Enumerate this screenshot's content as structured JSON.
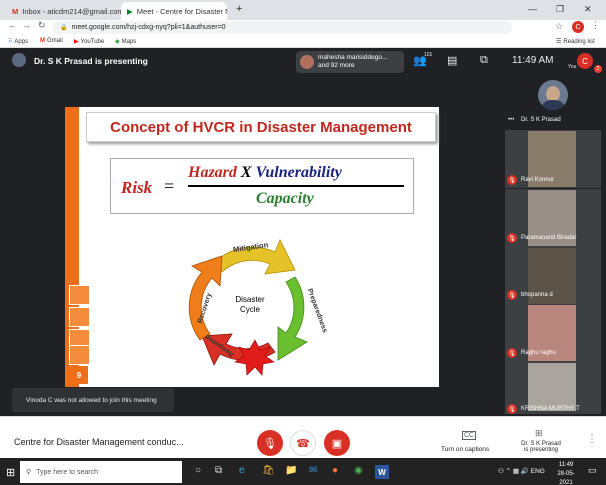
{
  "browser": {
    "tabs": [
      {
        "title": "Inbox - aticdm214@gmail.com -"
      },
      {
        "title": "Meet - Centre for Disaster M"
      }
    ],
    "new_tab": "+",
    "url": "meet.google.com/hzj-cdxg-nyq?pli=1&authuser=0",
    "profile_initial": "C",
    "bookmarks": [
      "Apps",
      "Gmail",
      "YouTube",
      "Maps"
    ],
    "reading_list": "Reading list"
  },
  "meet": {
    "presenter_banner": "Dr. S K Prasad is presenting",
    "hand_raise": {
      "line1": "mahesha marisiddego...",
      "line2": "and 92 more"
    },
    "participant_count": "101",
    "clock": "11:49 AM",
    "you_label": "You",
    "you_initial": "C",
    "badge": "2",
    "toast": "Vinoda C was not allowed to join this meeting",
    "meeting_title": "Centre for Disaster Management conduc...",
    "captions_label": "Turn on captions",
    "presenting_label": "Dr. S K Prasad is presenting",
    "participants": [
      {
        "name": "Dr. S K Prasad",
        "muted": false
      },
      {
        "name": "Ravi Konnur",
        "muted": true
      },
      {
        "name": "Paramanand Biradar",
        "muted": true
      },
      {
        "name": "bhopanna d",
        "muted": true
      },
      {
        "name": "Raghu raghu",
        "muted": true
      },
      {
        "name": "KRISHNA MURTHY T",
        "muted": true
      }
    ]
  },
  "slide": {
    "title": "Concept of HVCR in Disaster Management",
    "risk": "Risk",
    "equals": "=",
    "hazard": "Hazard",
    "times": "X",
    "vulnerability": "Vulnerability",
    "capacity": "Capacity",
    "cycle_center": "Disaster Cycle",
    "cycle_center_l1": "Disaster",
    "cycle_center_l2": "Cycle",
    "stage_mitigation": "Mitigation",
    "stage_preparedness": "Preparedness",
    "stage_response": "Response",
    "stage_recovery": "Recovery",
    "number": "9"
  },
  "taskbar": {
    "search_placeholder": "Type here to search",
    "language": "ENG",
    "time": "11:49",
    "date": "28-05-2021"
  },
  "colors": {
    "red": "#d93025",
    "orange": "#ee6f1a",
    "title_red": "#c0281f",
    "blue": "#1a237e",
    "green": "#2e7d32"
  }
}
